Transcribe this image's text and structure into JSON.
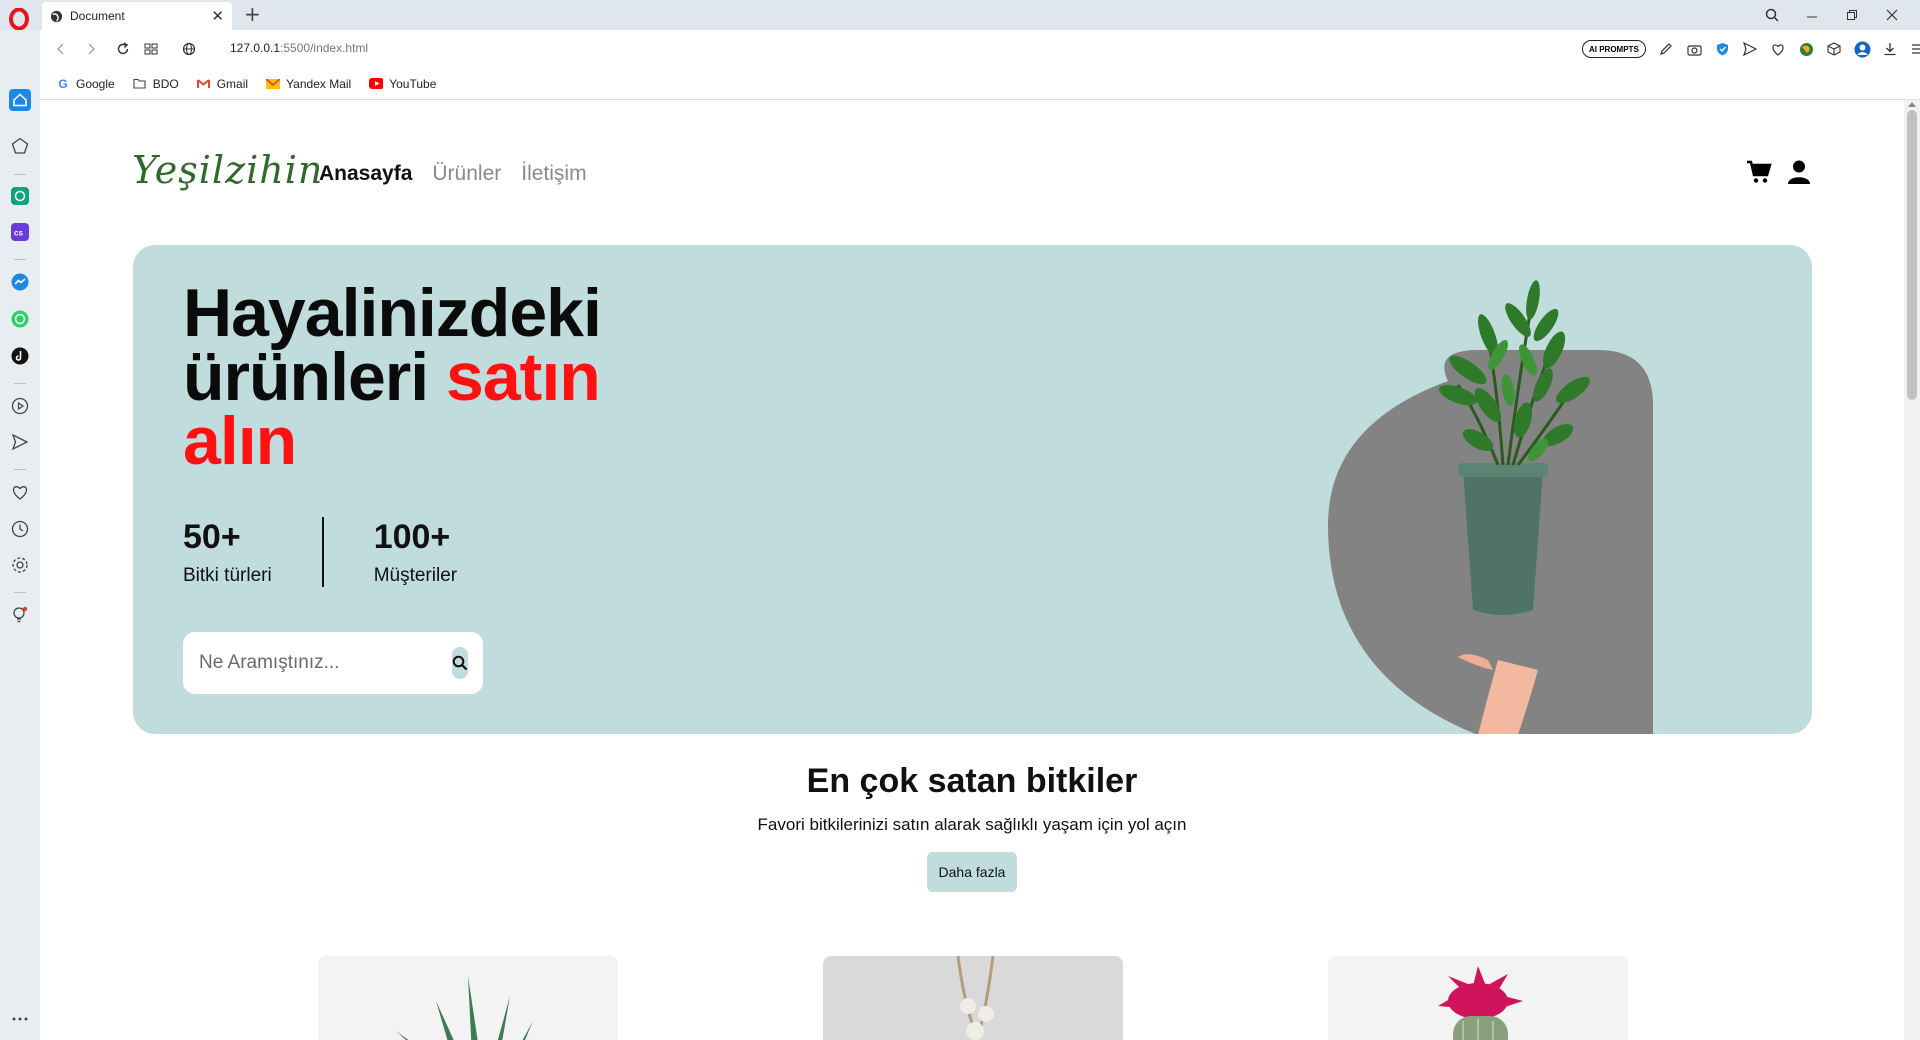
{
  "browser": {
    "tab_title": "Document",
    "url_host": "127.0.0.1",
    "url_rest": ":5500/index.html",
    "ai_prompts_label": "AI PROMPTS",
    "bookmarks": [
      "Google",
      "BDO",
      "Gmail",
      "Yandex Mail",
      "YouTube"
    ]
  },
  "site": {
    "logo": "Yeşilzihin",
    "nav": [
      "Anasayfa",
      "Ürünler",
      "İletişim"
    ],
    "active_nav": "Anasayfa"
  },
  "hero": {
    "title_line1": "Hayalinizdeki",
    "title_line2_black": "ürünleri ",
    "title_line2_red": "satın",
    "title_line3_red": "alın",
    "stats": [
      {
        "value": "50+",
        "label": "Bitki türleri"
      },
      {
        "value": "100+",
        "label": "Müşteriler"
      }
    ],
    "search_placeholder": "Ne Aramıştınız...",
    "accent_red": "#ff1111",
    "bg_color": "#c1dcdd"
  },
  "bestsellers": {
    "title": "En çok satan bitkiler",
    "subtitle": "Favori bitkilerinizi satın alarak sağlıklı yaşam için yol açın",
    "more_button": "Daha fazla"
  }
}
